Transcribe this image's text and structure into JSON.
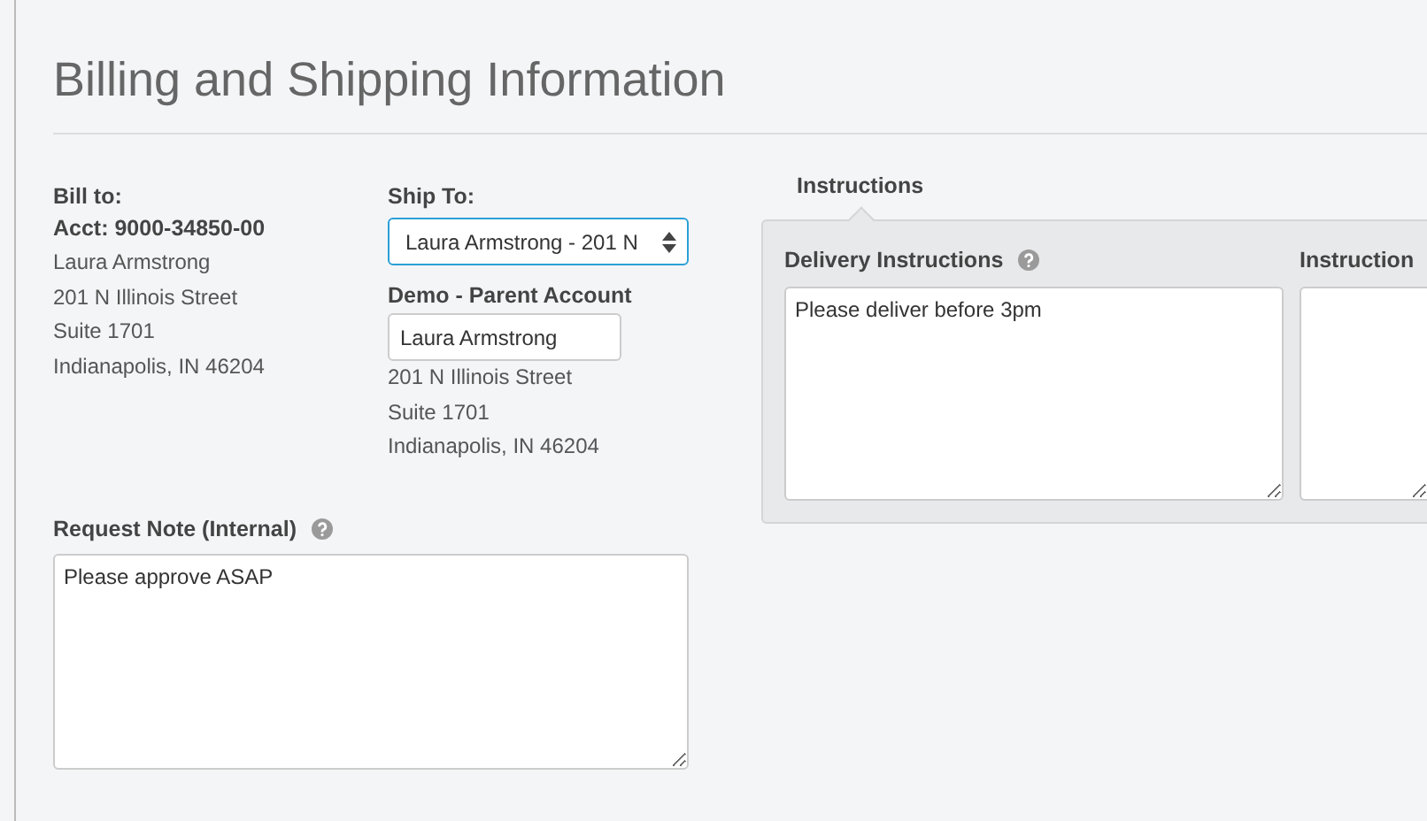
{
  "title": "Billing and Shipping Information",
  "bill_to": {
    "label": "Bill to:",
    "account": "Acct: 9000-34850-00",
    "lines": [
      "Laura Armstrong",
      "201 N Illinois Street",
      "Suite 1701",
      "Indianapolis, IN 46204"
    ]
  },
  "ship_to": {
    "label": "Ship To:",
    "select": {
      "value": "Laura Armstrong - 201 N"
    },
    "account_name": "Demo - Parent Account",
    "contact_field": {
      "value": "Laura Armstrong"
    },
    "lines": [
      "201 N Illinois Street",
      "Suite 1701",
      "Indianapolis, IN 46204"
    ]
  },
  "request_note": {
    "label": "Request Note (Internal)",
    "help": true,
    "value": "Please approve ASAP"
  },
  "instructions": {
    "label": "Instructions",
    "fields": [
      {
        "label": "Delivery Instructions",
        "help": true,
        "value": "Please deliver before 3pm"
      },
      {
        "label": "Instruction",
        "help": false
      }
    ]
  }
}
